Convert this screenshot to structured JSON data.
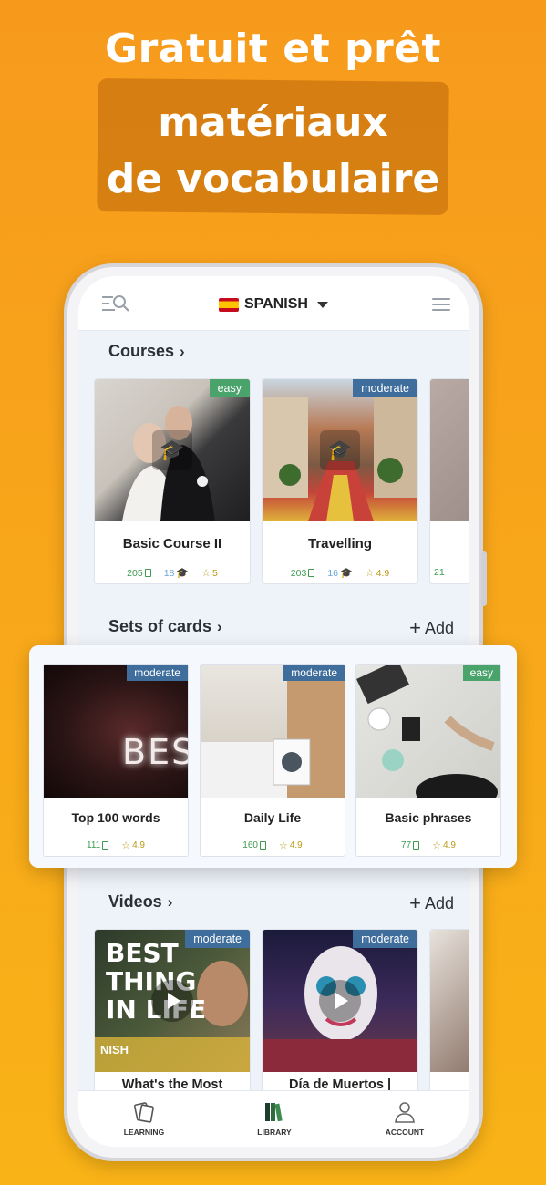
{
  "promo": {
    "title": "Gratuit et prêt",
    "subtitle_line1": "matériaux",
    "subtitle_line2": "de vocabulaire"
  },
  "header": {
    "language": "SPANISH",
    "menu_search_icon": "menu-search-icon",
    "hamburger_icon": "hamburger-icon"
  },
  "courses": {
    "title": "Courses",
    "chevron": "›",
    "items": [
      {
        "name": "Basic Course II",
        "level": "easy",
        "cards": "205",
        "lessons": "18",
        "rating": "5"
      },
      {
        "name": "Travelling",
        "level": "moderate",
        "cards": "203",
        "lessons": "16",
        "rating": "4.9"
      },
      {
        "name": "",
        "level": "",
        "cards": "21",
        "lessons": "",
        "rating": ""
      }
    ]
  },
  "sets": {
    "title": "Sets of cards",
    "chevron": "›",
    "add_label": "Add",
    "items": [
      {
        "name": "Top 100 words",
        "level": "moderate",
        "cards": "111",
        "rating": "4.9"
      },
      {
        "name": "Daily Life",
        "level": "moderate",
        "cards": "160",
        "rating": "4.9"
      },
      {
        "name": "Basic phrases",
        "level": "easy",
        "cards": "77",
        "rating": "4.9"
      }
    ]
  },
  "videos": {
    "title": "Videos",
    "chevron": "›",
    "add_label": "Add",
    "items": [
      {
        "name": "What's the Most",
        "level": "moderate",
        "thumb_text_1": "BEST",
        "thumb_text_2": "THING",
        "thumb_text_3": "IN LIFE",
        "thumb_caption": "NISH"
      },
      {
        "name": "Día de Muertos |",
        "level": "moderate"
      }
    ]
  },
  "bottom_nav": {
    "learning": "LEARNING",
    "library": "LIBRARY",
    "account": "ACCOUNT"
  },
  "colors": {
    "badge_easy": "#4aa36b",
    "badge_moderate": "#3f6e9c",
    "stat_cards": "#3d9a4e",
    "stat_lessons": "#6aa6d6",
    "stat_rating": "#b99a17",
    "background": "#f8a81a"
  }
}
